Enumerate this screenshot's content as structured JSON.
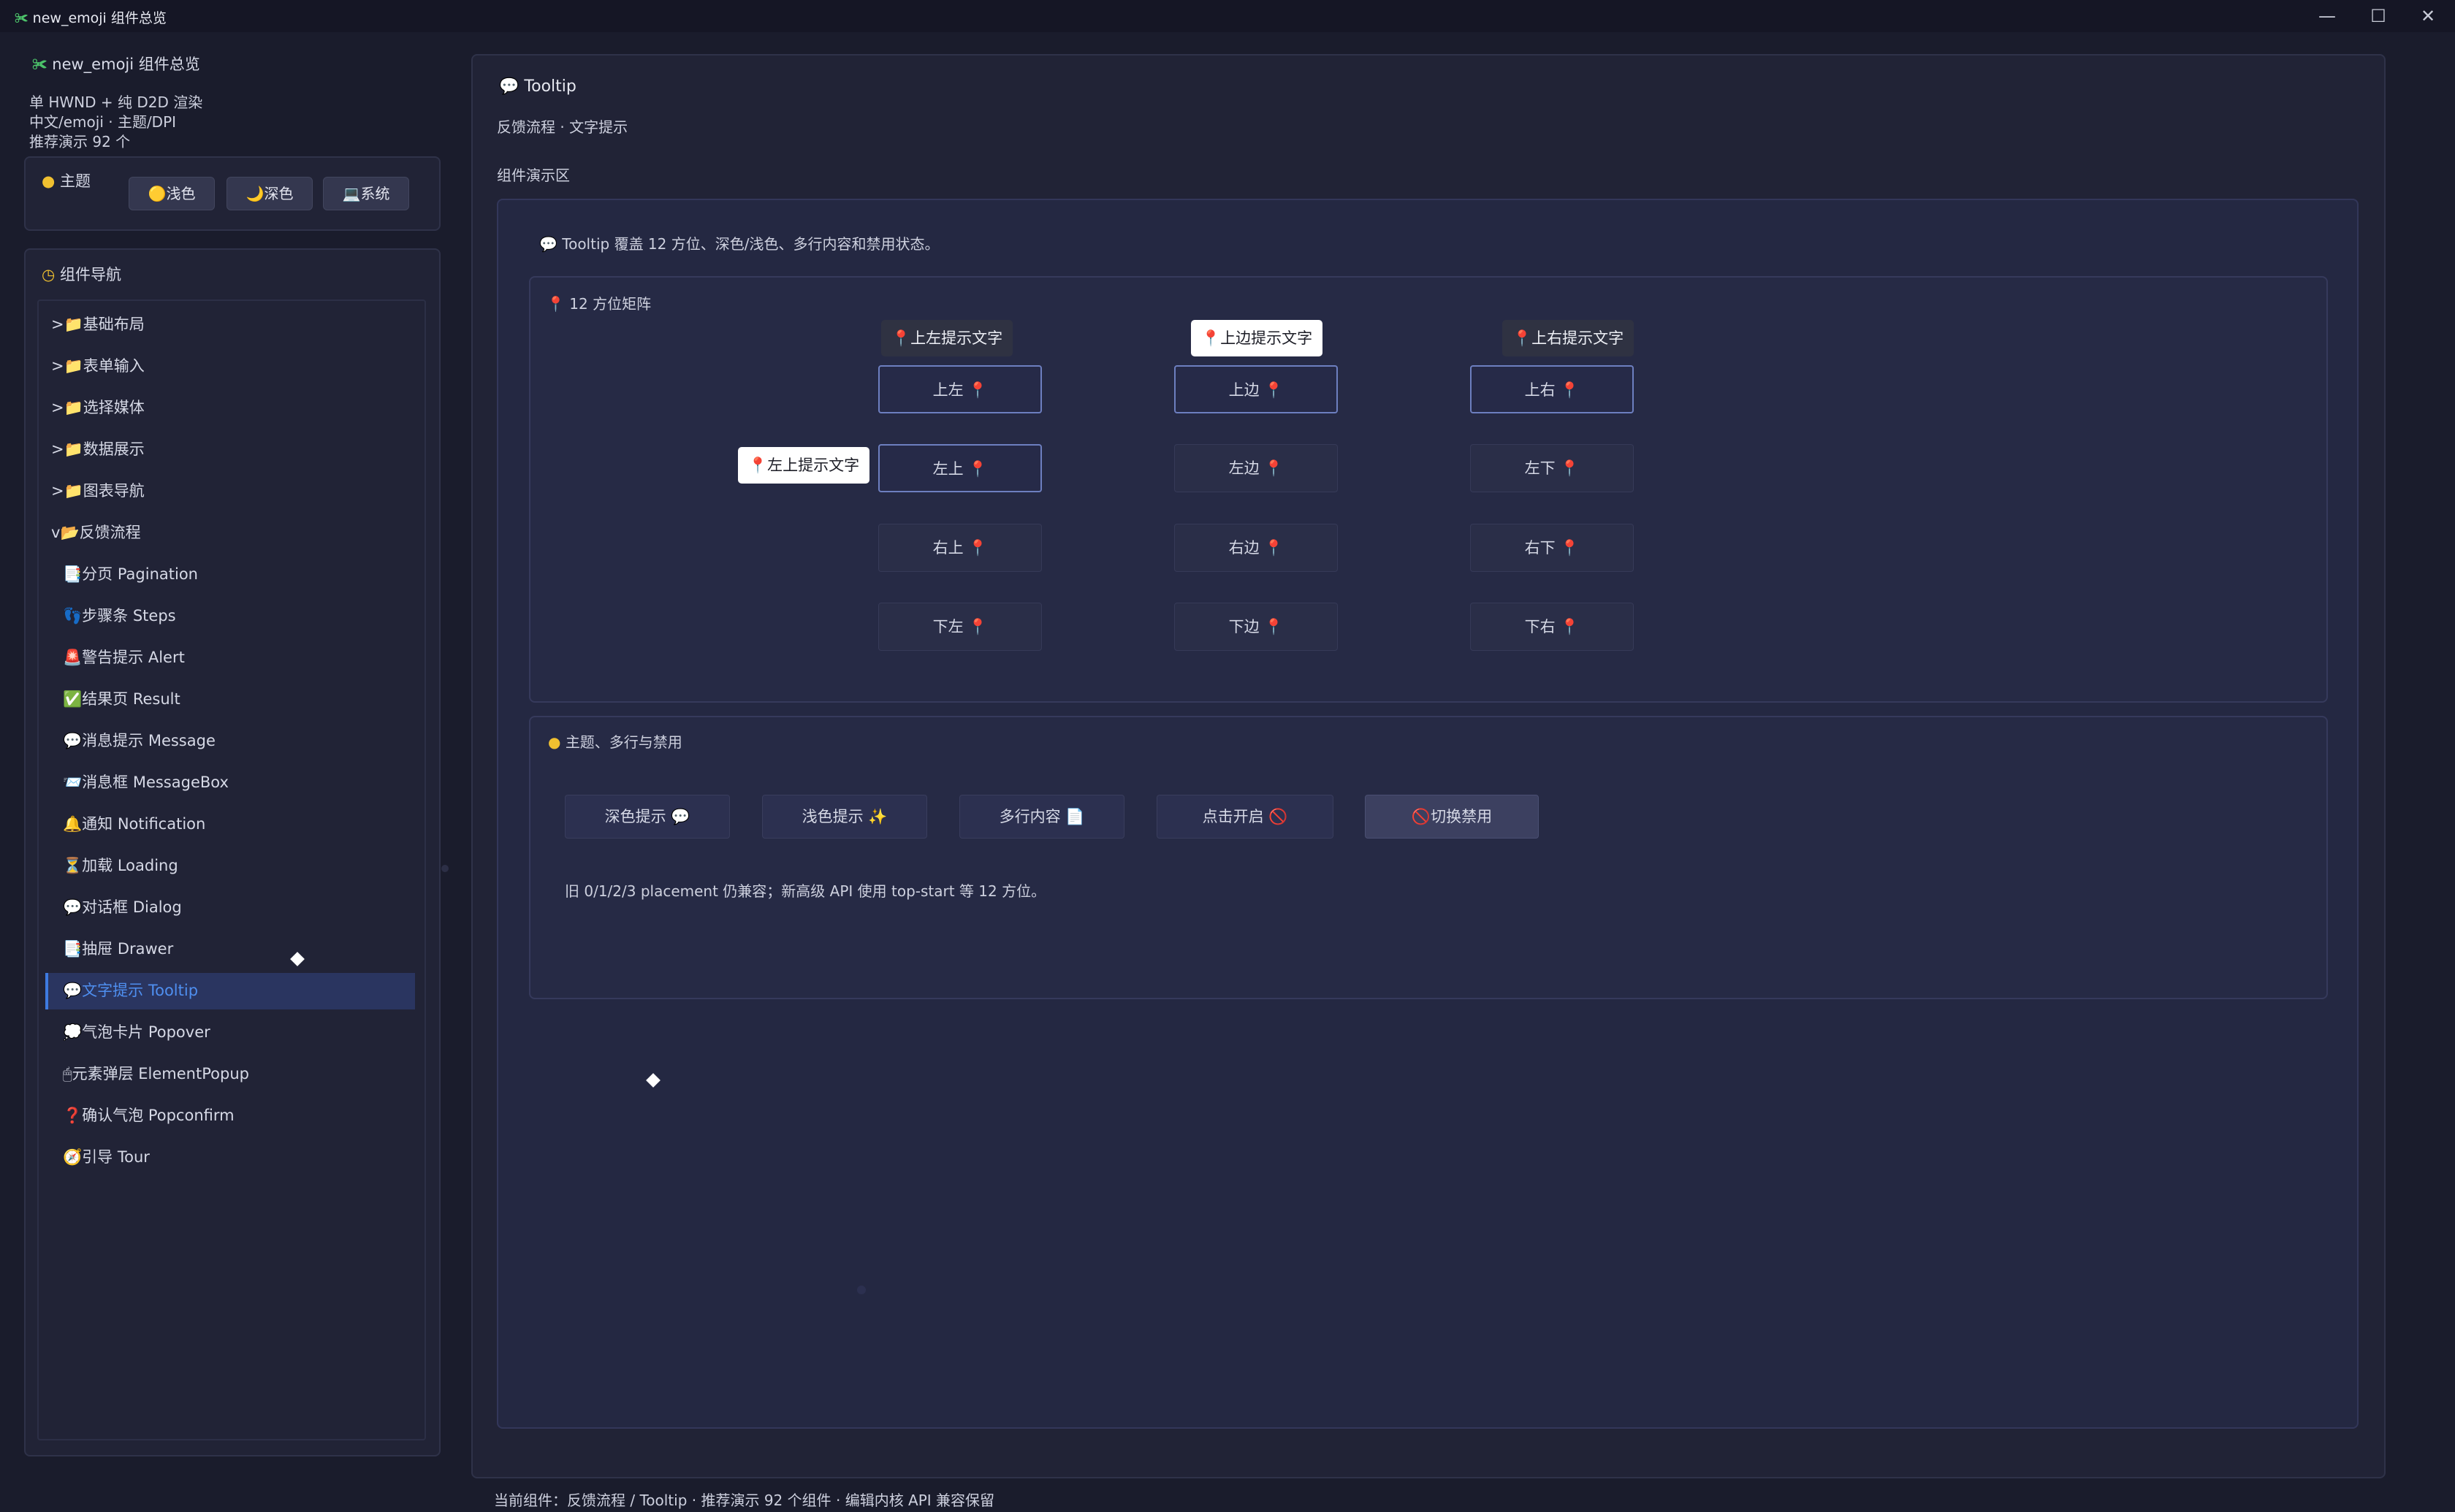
{
  "window": {
    "title": "new_emoji 组件总览",
    "app_icon": "✀",
    "controls": {
      "minimize": "—",
      "maximize": "☐",
      "close": "✕"
    }
  },
  "sidebar": {
    "app_name": "new_emoji 组件总览",
    "info_lines": [
      "单 HWND + 纯 D2D 渲染",
      "中文/emoji · 主题/DPI",
      "推荐演示 92 个"
    ],
    "theme": {
      "label": "主题",
      "options": [
        {
          "icon": "🟡",
          "label": "浅色"
        },
        {
          "icon": "🌙",
          "label": "深色"
        },
        {
          "icon": "💻",
          "label": "系统"
        }
      ]
    },
    "nav_title": "组件导航",
    "groups": [
      {
        "prefix": ">",
        "icon": "📁",
        "label": "基础布局"
      },
      {
        "prefix": ">",
        "icon": "📁",
        "label": "表单输入"
      },
      {
        "prefix": ">",
        "icon": "📁",
        "label": "选择媒体"
      },
      {
        "prefix": ">",
        "icon": "📁",
        "label": "数据展示"
      },
      {
        "prefix": ">",
        "icon": "📁",
        "label": "图表导航"
      },
      {
        "prefix": "v",
        "icon": "📂",
        "label": "反馈流程"
      }
    ],
    "items": [
      {
        "icon": "📑",
        "label": "分页 Pagination"
      },
      {
        "icon": "👣",
        "label": "步骤条 Steps"
      },
      {
        "icon": "🚨",
        "label": "警告提示 Alert"
      },
      {
        "icon": "✅",
        "label": "结果页 Result"
      },
      {
        "icon": "💬",
        "label": "消息提示 Message"
      },
      {
        "icon": "📨",
        "label": "消息框 MessageBox"
      },
      {
        "icon": "🔔",
        "label": "通知 Notification"
      },
      {
        "icon": "⏳",
        "label": "加载 Loading"
      },
      {
        "icon": "💬",
        "label": "对话框 Dialog"
      },
      {
        "icon": "📑",
        "label": "抽屉 Drawer"
      },
      {
        "icon": "💬",
        "label": "文字提示 Tooltip",
        "selected": true
      },
      {
        "icon": "💭",
        "label": "气泡卡片 Popover"
      },
      {
        "icon": "🖱",
        "label": "元素弹层 ElementPopup"
      },
      {
        "icon": "❓",
        "label": "确认气泡 Popconfirm"
      },
      {
        "icon": "🧭",
        "label": "引导 Tour"
      }
    ]
  },
  "main": {
    "title": "Tooltip",
    "subtitle": "反馈流程 · 文字提示",
    "demo_label": "组件演示区",
    "intro": "Tooltip 覆盖 12 方位、深色/浅色、多行内容和禁用状态。",
    "matrix": {
      "title": "12 方位矩阵",
      "tooltips": {
        "top_left": "上左提示文字",
        "top": "上边提示文字",
        "top_right": "上右提示文字",
        "left_top": "左上提示文字"
      },
      "buttons": [
        [
          "上左",
          "上边",
          "上右"
        ],
        [
          "左上",
          "左边",
          "左下"
        ],
        [
          "右上",
          "右边",
          "右下"
        ],
        [
          "下左",
          "下边",
          "下右"
        ]
      ]
    },
    "theme_section": {
      "title": "主题、多行与禁用",
      "buttons": [
        {
          "label": "深色提示",
          "icon": "💬"
        },
        {
          "label": "浅色提示",
          "icon": "✨"
        },
        {
          "label": "多行内容",
          "icon": "📄"
        },
        {
          "label": "点击开启",
          "icon": "🚫"
        },
        {
          "label": "切换禁用",
          "icon": "🚫"
        }
      ],
      "note": "旧 0/1/2/3 placement 仍兼容；新高级 API 使用 top-start 等 12 方位。"
    }
  },
  "status_bar": "当前组件：反馈流程 / Tooltip · 推荐演示 92 个组件 · 编辑内核 API 兼容保留"
}
